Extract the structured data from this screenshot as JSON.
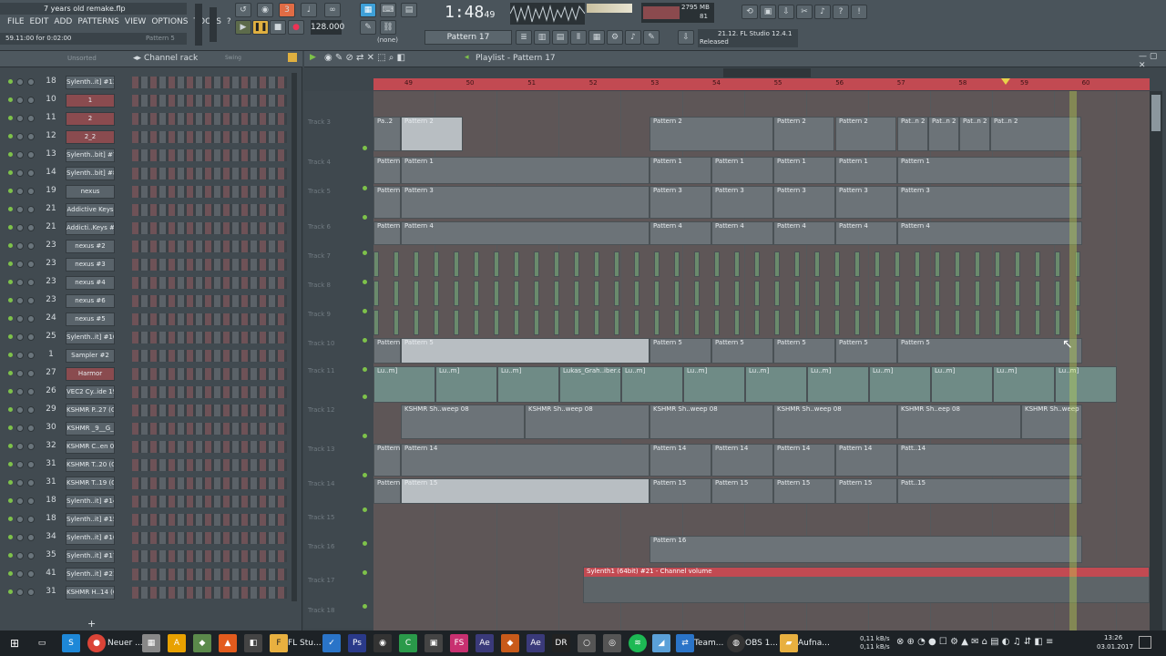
{
  "titlebar": {
    "project": "7 years old remake.flp",
    "hint": "59.11:00 for 0:02:00",
    "pattern_hint": "Pattern 5"
  },
  "menu": [
    "FILE",
    "EDIT",
    "ADD",
    "PATTERNS",
    "VIEW",
    "OPTIONS",
    "TOOLS",
    "?"
  ],
  "transport": {
    "time": "1:48",
    "time_small": "49",
    "tempo": "128.000",
    "pattern": "Pattern 17",
    "snap": "(none)",
    "memory": "2795 MB",
    "cpu": "81",
    "version_line1": "21.12. FL Studio 12.4.1",
    "version_line2": "Released"
  },
  "rack": {
    "title": "Channel rack",
    "filter": "Unsorted",
    "swing": "Swing",
    "channels": [
      {
        "num": "18",
        "name": "Sylenth..it] #13",
        "red": false
      },
      {
        "num": "10",
        "name": "1",
        "red": true
      },
      {
        "num": "11",
        "name": "2",
        "red": true
      },
      {
        "num": "12",
        "name": "2_2",
        "red": true
      },
      {
        "num": "13",
        "name": "Sylenth..bit] #7",
        "red": false
      },
      {
        "num": "14",
        "name": "Sylenth..bit] #8",
        "red": false
      },
      {
        "num": "19",
        "name": "nexus",
        "red": false
      },
      {
        "num": "21",
        "name": "Addictive Keys",
        "red": false
      },
      {
        "num": "21",
        "name": "Addicti..Keys #2",
        "red": false
      },
      {
        "num": "23",
        "name": "nexus #2",
        "red": false
      },
      {
        "num": "23",
        "name": "nexus #3",
        "red": false
      },
      {
        "num": "23",
        "name": "nexus #4",
        "red": false
      },
      {
        "num": "23",
        "name": "nexus #6",
        "red": false
      },
      {
        "num": "24",
        "name": "nexus #5",
        "red": false
      },
      {
        "num": "25",
        "name": "Sylenth..it] #10",
        "red": false
      },
      {
        "num": "1",
        "name": "Sampler #2",
        "red": false
      },
      {
        "num": "27",
        "name": "Harmor",
        "red": true
      },
      {
        "num": "26",
        "name": "VEC2 Cy..ide 19",
        "red": false
      },
      {
        "num": "29",
        "name": "KSHMR P..27 (G)",
        "red": false
      },
      {
        "num": "30",
        "name": "KSHMR _9__G_",
        "red": false
      },
      {
        "num": "32",
        "name": "KSHMR C..en 03",
        "red": false
      },
      {
        "num": "31",
        "name": "KSHMR T..20 (G)",
        "red": false
      },
      {
        "num": "31",
        "name": "KSHMR T..19 (G)",
        "red": false
      },
      {
        "num": "18",
        "name": "Sylenth..it] #14",
        "red": false
      },
      {
        "num": "18",
        "name": "Sylenth..it] #15",
        "red": false
      },
      {
        "num": "34",
        "name": "Sylenth..it] #16",
        "red": false
      },
      {
        "num": "35",
        "name": "Sylenth..it] #17",
        "red": false
      },
      {
        "num": "41",
        "name": "Sylenth..it] #21",
        "red": false
      },
      {
        "num": "31",
        "name": "KSHMR H..14 (G)",
        "red": false
      }
    ],
    "add": "+"
  },
  "playlist": {
    "title": "Playlist - Pattern 17",
    "bars": [
      "49",
      "50",
      "51",
      "52",
      "53",
      "54",
      "55",
      "56",
      "57",
      "58",
      "59",
      "60"
    ],
    "tracks": [
      "Track 3",
      "Track 4",
      "Track 5",
      "Track 6",
      "Track 7",
      "Track 8",
      "Track 9",
      "Track 10",
      "Track 11",
      "Track 12",
      "Track 13",
      "Track 14",
      "Track 15",
      "Track 16",
      "Track 17",
      "Track 18"
    ],
    "clips": {
      "p2": "Pattern 2",
      "p1": "Pattern 1",
      "p3": "Pattern 3",
      "p4": "Pattern 4",
      "p5": "Pattern 5",
      "lukas": "Lukas_Grah..iber.com]",
      "lu": "Lu..m]",
      "kshmr": "KSHMR Sh..weep 08",
      "kshmr2": "KSHMR Sh..eep 08",
      "p14": "Pattern 14",
      "p15": "Pattern 15",
      "p16": "Pattern 16",
      "auto": "Sylenth1 (64bit) #21 - Channel volume",
      "pat_n2": "Pat..n 2",
      "pa2": "Pa..2",
      "pat14": "Patt..14",
      "pat15": "Patt..15"
    }
  },
  "taskbar": {
    "items": [
      "Neuer ...",
      "FL Stu...",
      "Team...",
      "OBS 1...",
      "Aufna..."
    ],
    "net_up": "0,11 kB/s",
    "net_down": "0,11 kB/s",
    "time": "13:26",
    "date": "03.01.2017"
  }
}
